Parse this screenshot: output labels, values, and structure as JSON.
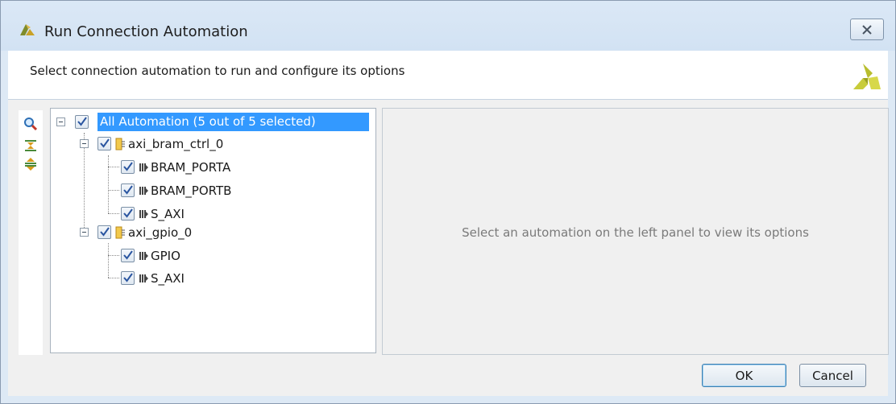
{
  "window": {
    "title": "Run Connection Automation",
    "close_icon": "close-icon"
  },
  "header": {
    "instruction": "Select connection automation to run and configure its options",
    "logo": "xilinx-logo"
  },
  "toolbar": {
    "icons": [
      "search-icon",
      "collapse-all-icon",
      "expand-all-icon"
    ]
  },
  "tree": {
    "root": {
      "label": "All Automation (5 out of 5 selected)",
      "checked": true,
      "expanded": true
    },
    "nodes": [
      {
        "label": "axi_bram_ctrl_0",
        "checked": true,
        "expanded": true,
        "children": [
          {
            "label": "BRAM_PORTA",
            "checked": true
          },
          {
            "label": "BRAM_PORTB",
            "checked": true
          },
          {
            "label": "S_AXI",
            "checked": true
          }
        ]
      },
      {
        "label": "axi_gpio_0",
        "checked": true,
        "expanded": true,
        "children": [
          {
            "label": "GPIO",
            "checked": true
          },
          {
            "label": "S_AXI",
            "checked": true
          }
        ]
      }
    ]
  },
  "options_panel": {
    "placeholder": "Select an automation on the left panel to view its options"
  },
  "buttons": {
    "ok": "OK",
    "cancel": "Cancel"
  },
  "colors": {
    "selection": "#3399ff",
    "accent": "#3c7fb1"
  }
}
